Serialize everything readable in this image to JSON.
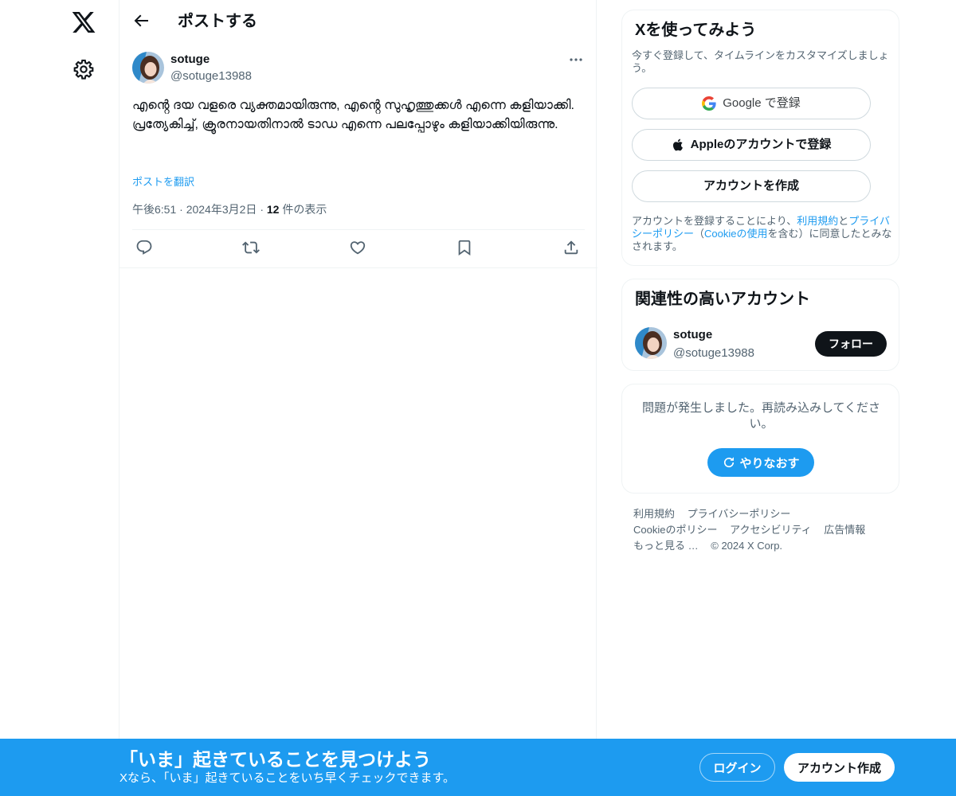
{
  "nav": {
    "logo_icon": "x-logo-icon",
    "settings_icon": "gear-icon"
  },
  "header": {
    "title": "ポストする",
    "back_icon": "arrow-left-icon"
  },
  "post": {
    "author_name": "sotuge",
    "author_handle": "@sotuge13988",
    "text": "എൻ്റെ ദയ വളരെ വ്യക്തമായിരുന്നു, എൻ്റെ സുഹൃത്തുക്കൾ എന്നെ കളിയാക്കി.\nപ്രത്യേകിച്ച്, ക്രൂരനായതിനാൽ ടാഡ എന്നെ പലപ്പോഴും കളിയാക്കിയിരുന്നു.",
    "translate_label": "ポストを翻訳",
    "time": "午後6:51",
    "date": "2024年3月2日",
    "views_count": "12",
    "views_label": "件の表示",
    "action_icons": [
      "reply-icon",
      "repost-icon",
      "like-icon",
      "bookmark-icon",
      "share-icon"
    ]
  },
  "signup": {
    "title": "Xを使ってみよう",
    "subtitle": "今すぐ登録して、タイムラインをカスタマイズしましょう。",
    "google_label": "Google で登録",
    "apple_label": "Appleのアカウントで登録",
    "create_label": "アカウントを作成",
    "terms_prefix": "アカウントを登録することにより、",
    "terms_link": "利用規約",
    "terms_and": "と",
    "privacy_link": "プライバシーポリシー",
    "cookie_open": "（",
    "cookie_link": "Cookieの使用",
    "terms_suffix": "を含む）に同意したとみなされます。"
  },
  "related": {
    "title": "関連性の高いアカウント",
    "name": "sotuge",
    "handle": "@sotuge13988",
    "follow_label": "フォロー"
  },
  "error": {
    "message": "問題が発生しました。再読み込みしてください。",
    "retry_label": "やりなおす"
  },
  "footer": {
    "terms": "利用規約",
    "privacy": "プライバシーポリシー",
    "cookie": "Cookieのポリシー",
    "accessibility": "アクセシビリティ",
    "ads": "広告情報",
    "more": "もっと見る …",
    "copyright": "© 2024 X Corp."
  },
  "banner": {
    "title": "「いま」起きていることを見つけよう",
    "subtitle": "Xなら、「いま」起きていることをいち早くチェックできます。",
    "login_label": "ログイン",
    "signup_label": "アカウント作成"
  },
  "colors": {
    "accent": "#1d9bf0",
    "text": "#0f1419",
    "muted": "#536471",
    "border": "#eff3f4"
  }
}
